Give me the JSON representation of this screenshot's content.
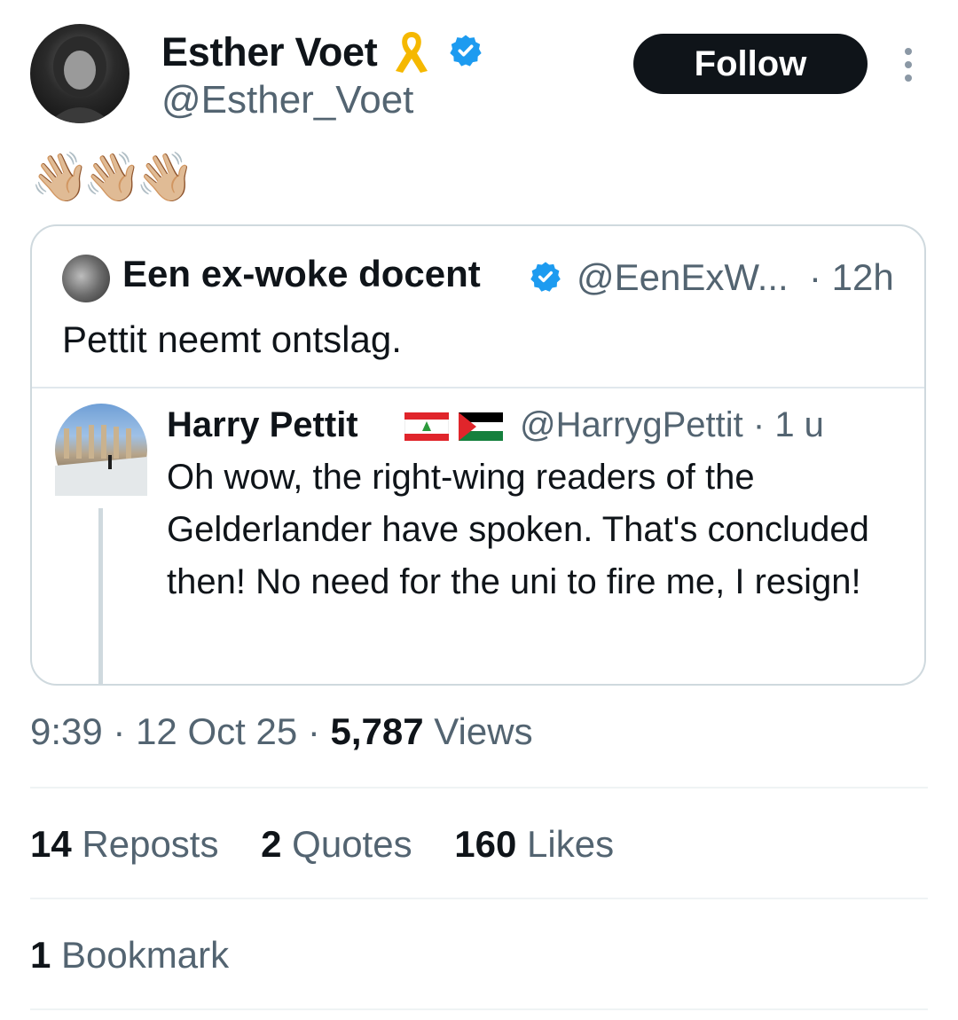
{
  "author": {
    "name": "Esther Voet",
    "handle": "@Esther_Voet",
    "follow_label": "Follow"
  },
  "tweet": {
    "text": "👋🏼👋🏼👋🏼"
  },
  "quoted": {
    "name": "Een ex-woke docent",
    "handle": "@EenExW...",
    "time": "· 12h",
    "text": "Pettit neemt ontslag.",
    "nested": {
      "name": "Harry Pettit",
      "handle": "@HarrygPettit · 1 u",
      "text": "Oh wow, the right-wing readers of the Gelderlander have spoken. That's concluded then! No need for the uni to fire me, I resign!"
    }
  },
  "meta": {
    "time": "9:39",
    "date": "12 Oct 25",
    "views_count": "5,787",
    "views_label": "Views"
  },
  "stats": {
    "reposts_count": "14",
    "reposts_label": "Reposts",
    "quotes_count": "2",
    "quotes_label": "Quotes",
    "likes_count": "160",
    "likes_label": "Likes",
    "bookmarks_count": "1",
    "bookmarks_label": "Bookmark"
  },
  "colors": {
    "verified": "#1d9bf0",
    "secondary_text": "#536471",
    "follow_bg": "#0f1419",
    "ribbon": "#f5b800"
  },
  "icons": [
    "more-vertical-icon",
    "verified-badge-icon",
    "gold-ribbon-icon",
    "lebanon-flag-icon",
    "palestine-flag-icon"
  ]
}
